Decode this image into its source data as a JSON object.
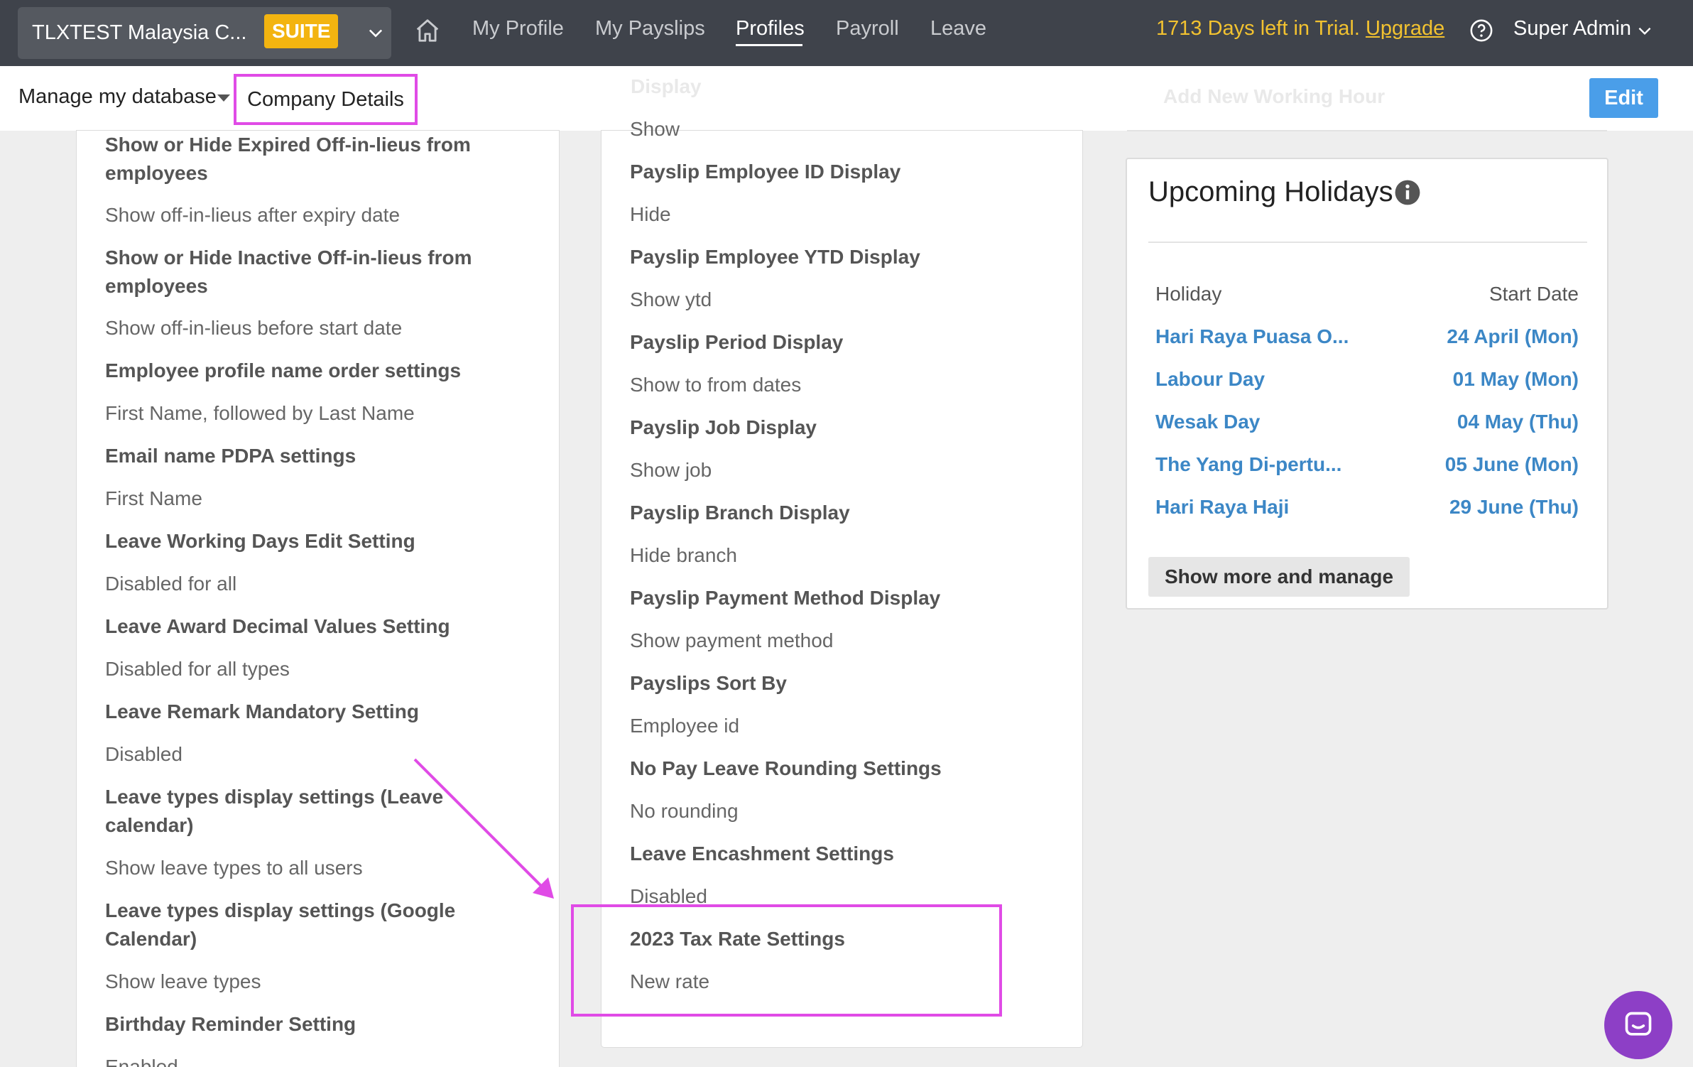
{
  "topbar": {
    "company_name": "TLXTEST Malaysia C...",
    "suite_badge": "SUITE",
    "nav": [
      "My Profile",
      "My Payslips",
      "Profiles",
      "Payroll",
      "Leave"
    ],
    "trial_text": "1713 Days left in Trial.",
    "upgrade_link": "Upgrade",
    "user_name": "Super Admin",
    "active_color": "#ffffff",
    "trial_color": "#f2c230"
  },
  "subbar": {
    "manage_db": "Manage my database",
    "company_details": "Company Details",
    "ghost_display": "Display",
    "ghost_working_hour": "Add New Working Hour",
    "edit_button": "Edit"
  },
  "left_settings": [
    {
      "title": "Show or Hide Expired Off-in-lieus from employees",
      "value": "Show off-in-lieus after expiry date"
    },
    {
      "title": "Show or Hide Inactive Off-in-lieus from employees",
      "value": "Show off-in-lieus before start date"
    },
    {
      "title": "Employee profile name order settings",
      "value": "First Name, followed by Last Name"
    },
    {
      "title": "Email name PDPA settings",
      "value": "First Name"
    },
    {
      "title": "Leave Working Days Edit Setting",
      "value": "Disabled for all"
    },
    {
      "title": "Leave Award Decimal Values Setting",
      "value": "Disabled for all types"
    },
    {
      "title": "Leave Remark Mandatory Setting",
      "value": "Disabled"
    },
    {
      "title": "Leave types display settings (Leave calendar)",
      "value": "Show leave types to all users"
    },
    {
      "title": "Leave types display settings (Google Calendar)",
      "value": "Show leave types"
    },
    {
      "title": "Birthday Reminder Setting",
      "value": "Enabled"
    }
  ],
  "mid_settings": {
    "top_value": "Show",
    "items": [
      {
        "title": "Payslip Employee ID Display",
        "value": "Hide"
      },
      {
        "title": "Payslip Employee YTD Display",
        "value": "Show ytd"
      },
      {
        "title": "Payslip Period Display",
        "value": "Show to from dates"
      },
      {
        "title": "Payslip Job Display",
        "value": "Show job"
      },
      {
        "title": "Payslip Branch Display",
        "value": "Hide branch"
      },
      {
        "title": "Payslip Payment Method Display",
        "value": "Show payment method"
      },
      {
        "title": "Payslips Sort By",
        "value": "Employee id"
      },
      {
        "title": "No Pay Leave Rounding Settings",
        "value": "No rounding"
      },
      {
        "title": "Leave Encashment Settings",
        "value": "Disabled"
      },
      {
        "title": "2023 Tax Rate Settings",
        "value": "New rate"
      }
    ]
  },
  "holidays": {
    "title": "Upcoming Holidays",
    "col_holiday": "Holiday",
    "col_start": "Start Date",
    "rows": [
      {
        "name": "Hari Raya Puasa O...",
        "date": "24 April (Mon)"
      },
      {
        "name": "Labour Day",
        "date": "01 May (Mon)"
      },
      {
        "name": "Wesak Day",
        "date": "04 May (Thu)"
      },
      {
        "name": "The Yang Di-pertu...",
        "date": "05 June (Mon)"
      },
      {
        "name": "Hari Raya Haji",
        "date": "29 June (Thu)"
      }
    ],
    "show_more": "Show more and manage",
    "link_color": "#3c87c6"
  },
  "annotation_color": "#e04be6"
}
